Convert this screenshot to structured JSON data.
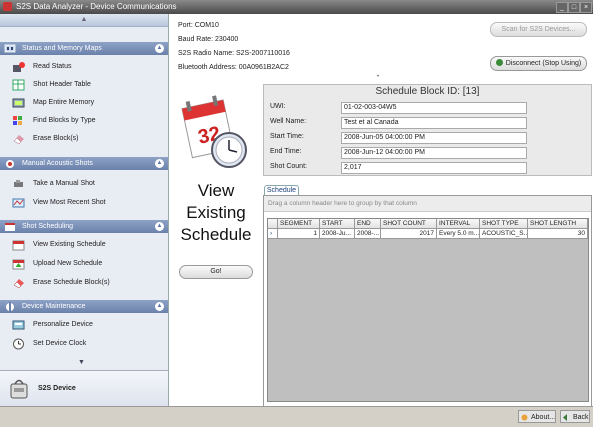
{
  "window": {
    "title": "S2S Data Analyzer - Device Communications"
  },
  "sidebar": {
    "sections": [
      {
        "label": "Status and Memory Maps",
        "items": [
          "Read Status",
          "Shot Header Table",
          "Map Entire Memory",
          "Find Blocks by Type",
          "Erase Block(s)"
        ]
      },
      {
        "label": "Manual Acoustic Shots",
        "items": [
          "Take a Manual Shot",
          "View Most Recent Shot"
        ]
      },
      {
        "label": "Shot Scheduling",
        "items": [
          "View Existing Schedule",
          "Upload New Schedule",
          "Erase Schedule Block(s)"
        ]
      },
      {
        "label": "Device Maintenance",
        "items": [
          "Personalize Device",
          "Set Device Clock"
        ]
      }
    ],
    "footer_label": "S2S Device"
  },
  "connection": {
    "port": "Port: COM10",
    "baud": "Baud Rate: 230400",
    "radio": "S2S Radio Name: S2S-2007110016",
    "bluetooth": "Bluetooth Address: 00A0961B2AC2"
  },
  "buttons": {
    "scan": "Scan for S2S Devices...",
    "disconnect": "Disconnect (Stop Using)",
    "go": "Go!",
    "about": "About...",
    "back": "Back"
  },
  "view_title": [
    "View",
    "Existing",
    "Schedule"
  ],
  "calendar_day": "32",
  "schedule": {
    "header": "Schedule Block ID: [13]",
    "fields": [
      {
        "label": "UWI:",
        "value": "01-02-003-04W5"
      },
      {
        "label": "Well Name:",
        "value": "Test et al Canada"
      },
      {
        "label": "Start Time:",
        "value": "2008-Jun-05  04:00:00 PM"
      },
      {
        "label": "End Time:",
        "value": "2008-Jun-12  04:00:00 PM"
      },
      {
        "label": "Shot Count:",
        "value": "2,017"
      }
    ]
  },
  "grid": {
    "tab": "Schedule",
    "group_hint": "Drag a column header here to group by that column",
    "columns": [
      "SEGMENT",
      "START",
      "END",
      "SHOT COUNT",
      "INTERVAL",
      "SHOT TYPE",
      "SHOT LENGTH"
    ],
    "rows": [
      {
        "indicator": "›",
        "cells": [
          "1",
          "2008-Ju...",
          "2008-...",
          "2017",
          "Every 5.0 m...",
          "ACOUSTIC_S...",
          "30"
        ]
      }
    ]
  },
  "colors": {
    "section_header": "#6a81ab",
    "sidebar_bg": "#e8ecf3",
    "titlebar": "#4a4a4a"
  }
}
